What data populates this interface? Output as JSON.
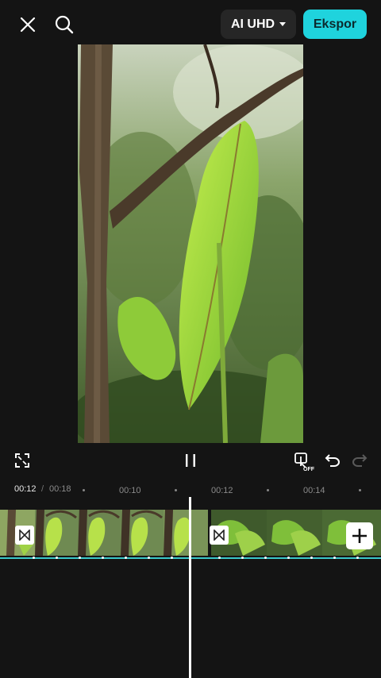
{
  "toolbar": {
    "quality_label": "AI UHD",
    "export_label": "Ekspor"
  },
  "controls": {
    "keyframe_badge": "OFF"
  },
  "ruler": {
    "current_time": "00:12",
    "separator": "/",
    "total_time": "00:18",
    "ticks": [
      "00:10",
      "00:12",
      "00:14"
    ]
  },
  "colors": {
    "accent": "#1fd3dd",
    "background": "#141414",
    "audio_line": "#3bc7c9"
  },
  "icons": {
    "close": "close-icon",
    "search": "search-icon",
    "fullscreen": "fullscreen-icon",
    "pause": "pause-icon",
    "keyframe": "keyframe-icon",
    "undo": "undo-icon",
    "redo": "redo-icon",
    "transition": "transition-icon",
    "add": "plus-icon"
  }
}
